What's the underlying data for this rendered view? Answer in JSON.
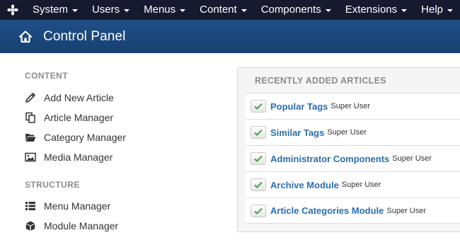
{
  "topnav": {
    "logo": "joomla-logo",
    "items": [
      {
        "label": "System"
      },
      {
        "label": "Users"
      },
      {
        "label": "Menus"
      },
      {
        "label": "Content"
      },
      {
        "label": "Components"
      },
      {
        "label": "Extensions"
      },
      {
        "label": "Help"
      }
    ]
  },
  "header": {
    "title": "Control Panel",
    "icon": "home-icon"
  },
  "sidebar": {
    "content_title": "CONTENT",
    "content_items": [
      {
        "label": "Add New Article",
        "icon": "pencil-icon"
      },
      {
        "label": "Article Manager",
        "icon": "copy-icon"
      },
      {
        "label": "Category Manager",
        "icon": "folder-open-icon"
      },
      {
        "label": "Media Manager",
        "icon": "image-icon"
      }
    ],
    "structure_title": "STRUCTURE",
    "structure_items": [
      {
        "label": "Menu Manager",
        "icon": "list-icon"
      },
      {
        "label": "Module Manager",
        "icon": "cube-icon"
      }
    ]
  },
  "articles": {
    "title": "RECENTLY ADDED ARTICLES",
    "items": [
      {
        "title": "Popular Tags",
        "author": "Super User"
      },
      {
        "title": "Similar Tags",
        "author": "Super User"
      },
      {
        "title": "Administrator Components",
        "author": "Super User"
      },
      {
        "title": "Archive Module",
        "author": "Super User"
      },
      {
        "title": "Article Categories Module",
        "author": "Super User"
      }
    ]
  },
  "colors": {
    "topnav_bg": "#171a2f",
    "header_bg": "#1f4f88",
    "link": "#2a6fb3",
    "check": "#52a552"
  }
}
